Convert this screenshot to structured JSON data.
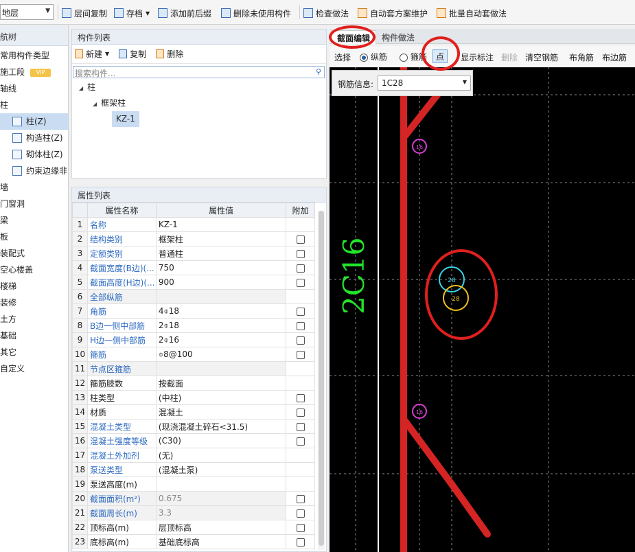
{
  "toolbar": {
    "floor_value": "地层",
    "items": [
      "层间复制",
      "存档",
      "添加前后缀",
      "删除未使用构件",
      "检查做法",
      "自动套方案维护",
      "批量自动套做法"
    ]
  },
  "leftnav": {
    "title": "航树",
    "items": [
      "常用构件类型",
      "施工段",
      "轴线",
      "柱",
      "墙",
      "门窗洞",
      "梁",
      "板",
      "装配式",
      "空心楼盖",
      "楼梯",
      "装修",
      "土方",
      "基础",
      "其它",
      "自定义"
    ],
    "vip_label": "VIP",
    "column_children": [
      "柱(Z)",
      "构造柱(Z)",
      "砌体柱(Z)",
      "约束边缘非"
    ]
  },
  "complist": {
    "title": "构件列表",
    "new_label": "新建",
    "copy_label": "复制",
    "delete_label": "删除",
    "search_placeholder": "搜索构件...",
    "tree": [
      "柱",
      "框架柱",
      "KZ-1"
    ]
  },
  "props": {
    "title": "属性列表",
    "headers": [
      "属性名称",
      "属性值",
      "附加"
    ],
    "rows": [
      {
        "n": "1",
        "name": "名称",
        "value": "KZ-1"
      },
      {
        "n": "2",
        "name": "结构类别",
        "value": "框架柱"
      },
      {
        "n": "3",
        "name": "定额类别",
        "value": "普通柱"
      },
      {
        "n": "4",
        "name": "截面宽度(B边)(...",
        "value": "750"
      },
      {
        "n": "5",
        "name": "截面高度(H边)(...",
        "value": "900"
      },
      {
        "n": "6",
        "name": "全部纵筋",
        "value": ""
      },
      {
        "n": "7",
        "name": "角筋",
        "value": "4⌽18"
      },
      {
        "n": "8",
        "name": "B边一侧中部筋",
        "value": "2⌽18"
      },
      {
        "n": "9",
        "name": "H边一侧中部筋",
        "value": "2⌽16"
      },
      {
        "n": "10",
        "name": "箍筋",
        "value": "⌽8@100"
      },
      {
        "n": "11",
        "name": "节点区箍筋",
        "value": ""
      },
      {
        "n": "12",
        "name": "箍筋肢数",
        "value": "按截面"
      },
      {
        "n": "13",
        "name": "柱类型",
        "value": "(中柱)"
      },
      {
        "n": "14",
        "name": "材质",
        "value": "混凝土"
      },
      {
        "n": "15",
        "name": "混凝土类型",
        "value": "(现浇混凝土碎石<31.5)"
      },
      {
        "n": "16",
        "name": "混凝土强度等级",
        "value": "(C30)"
      },
      {
        "n": "17",
        "name": "混凝土外加剂",
        "value": "(无)"
      },
      {
        "n": "18",
        "name": "泵送类型",
        "value": "(混凝土泵)"
      },
      {
        "n": "19",
        "name": "泵送高度(m)",
        "value": ""
      },
      {
        "n": "20",
        "name": "截面面积(m²)",
        "value": "0.675"
      },
      {
        "n": "21",
        "name": "截面周长(m)",
        "value": "3.3"
      },
      {
        "n": "22",
        "name": "顶标高(m)",
        "value": "层顶标高"
      },
      {
        "n": "23",
        "name": "底标高(m)",
        "value": "基础底标高"
      }
    ]
  },
  "section": {
    "tab_edit": "截面编辑",
    "tab_method": "构件做法",
    "select": "选择",
    "longitudinal": "纵筋",
    "stirrup": "箍筋",
    "point": "点",
    "show_label": "显示标注",
    "delete": "删除",
    "clear": "清空钢筋",
    "corner": "布角筋",
    "edge": "布边筋",
    "info_label": "钢筋信息:",
    "info_value": "1C28",
    "green_label": "2C16",
    "bar_small_label": "16",
    "bar_cyan_label": "28",
    "bar_yellow_label": "28"
  }
}
